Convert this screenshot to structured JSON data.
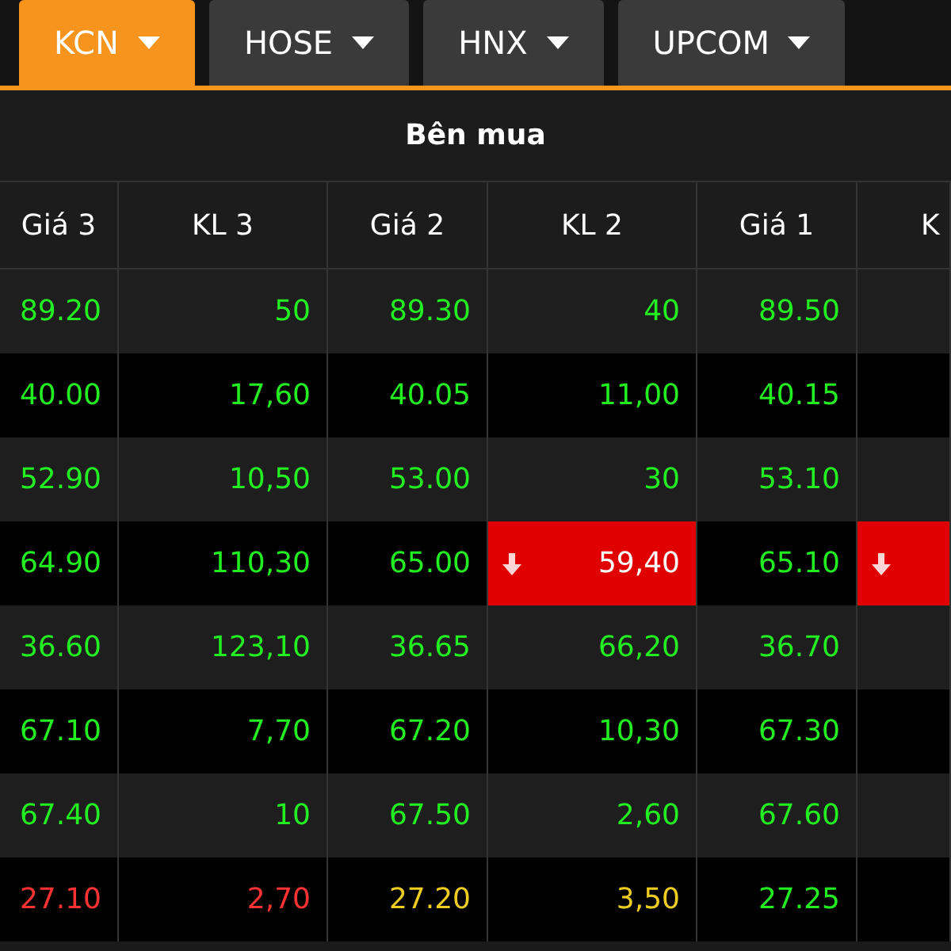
{
  "tabs": [
    {
      "label": "KCN",
      "selected": true
    },
    {
      "label": "HOSE",
      "selected": false
    },
    {
      "label": "HNX",
      "selected": false
    },
    {
      "label": "UPCOM",
      "selected": false
    }
  ],
  "table": {
    "group_header": "Bên mua",
    "columns": [
      "Giá 3",
      "KL 3",
      "Giá 2",
      "KL 2",
      "Giá 1",
      "K"
    ],
    "rows": [
      {
        "cells": [
          {
            "text": "89.20",
            "color": "#22ee22",
            "highlighted": false
          },
          {
            "text": "50",
            "color": "#22ee22",
            "highlighted": false
          },
          {
            "text": "89.30",
            "color": "#22ee22",
            "highlighted": false
          },
          {
            "text": "40",
            "color": "#22ee22",
            "highlighted": false
          },
          {
            "text": "89.50",
            "color": "#22ee22",
            "highlighted": false
          },
          {
            "highlighted": false
          }
        ]
      },
      {
        "cells": [
          {
            "text": "40.00",
            "color": "#22ee22",
            "highlighted": false
          },
          {
            "text": "17,60",
            "color": "#22ee22",
            "highlighted": false
          },
          {
            "text": "40.05",
            "color": "#22ee22",
            "highlighted": false
          },
          {
            "text": "11,00",
            "color": "#22ee22",
            "highlighted": false
          },
          {
            "text": "40.15",
            "color": "#22ee22",
            "highlighted": false
          },
          {
            "highlighted": false
          }
        ]
      },
      {
        "cells": [
          {
            "text": "52.90",
            "color": "#22ee22",
            "highlighted": false
          },
          {
            "text": "10,50",
            "color": "#22ee22",
            "highlighted": false
          },
          {
            "text": "53.00",
            "color": "#22ee22",
            "highlighted": false
          },
          {
            "text": "30",
            "color": "#22ee22",
            "highlighted": false
          },
          {
            "text": "53.10",
            "color": "#22ee22",
            "highlighted": false
          },
          {
            "highlighted": false
          }
        ]
      },
      {
        "cells": [
          {
            "text": "64.90",
            "color": "#22ee22",
            "highlighted": false
          },
          {
            "text": "110,30",
            "color": "#22ee22",
            "highlighted": false
          },
          {
            "text": "65.00",
            "color": "#22ee22",
            "highlighted": false
          },
          {
            "text": "59,40",
            "color": "#ffffff",
            "highlighted": true
          },
          {
            "text": "65.10",
            "color": "#22ee22",
            "highlighted": false
          },
          {
            "highlighted": true
          }
        ]
      },
      {
        "cells": [
          {
            "text": "36.60",
            "color": "#22ee22",
            "highlighted": false
          },
          {
            "text": "123,10",
            "color": "#22ee22",
            "highlighted": false
          },
          {
            "text": "36.65",
            "color": "#22ee22",
            "highlighted": false
          },
          {
            "text": "66,20",
            "color": "#22ee22",
            "highlighted": false
          },
          {
            "text": "36.70",
            "color": "#22ee22",
            "highlighted": false
          },
          {
            "highlighted": false
          }
        ]
      },
      {
        "cells": [
          {
            "text": "67.10",
            "color": "#22ee22",
            "highlighted": false
          },
          {
            "text": "7,70",
            "color": "#22ee22",
            "highlighted": false
          },
          {
            "text": "67.20",
            "color": "#22ee22",
            "highlighted": false
          },
          {
            "text": "10,30",
            "color": "#22ee22",
            "highlighted": false
          },
          {
            "text": "67.30",
            "color": "#22ee22",
            "highlighted": false
          },
          {
            "highlighted": false
          }
        ]
      },
      {
        "cells": [
          {
            "text": "67.40",
            "color": "#22ee22",
            "highlighted": false
          },
          {
            "text": "10",
            "color": "#22ee22",
            "highlighted": false
          },
          {
            "text": "67.50",
            "color": "#22ee22",
            "highlighted": false
          },
          {
            "text": "2,60",
            "color": "#22ee22",
            "highlighted": false
          },
          {
            "text": "67.60",
            "color": "#22ee22",
            "highlighted": false
          },
          {
            "highlighted": false
          }
        ]
      },
      {
        "cells": [
          {
            "text": "27.10",
            "color": "#ff3333",
            "highlighted": false
          },
          {
            "text": "2,70",
            "color": "#ff3333",
            "highlighted": false
          },
          {
            "text": "27.20",
            "color": "#eecc22",
            "highlighted": false
          },
          {
            "text": "3,50",
            "color": "#eecc22",
            "highlighted": false
          },
          {
            "text": "27.25",
            "color": "#22ee22",
            "highlighted": false
          },
          {
            "highlighted": false
          }
        ]
      }
    ]
  }
}
